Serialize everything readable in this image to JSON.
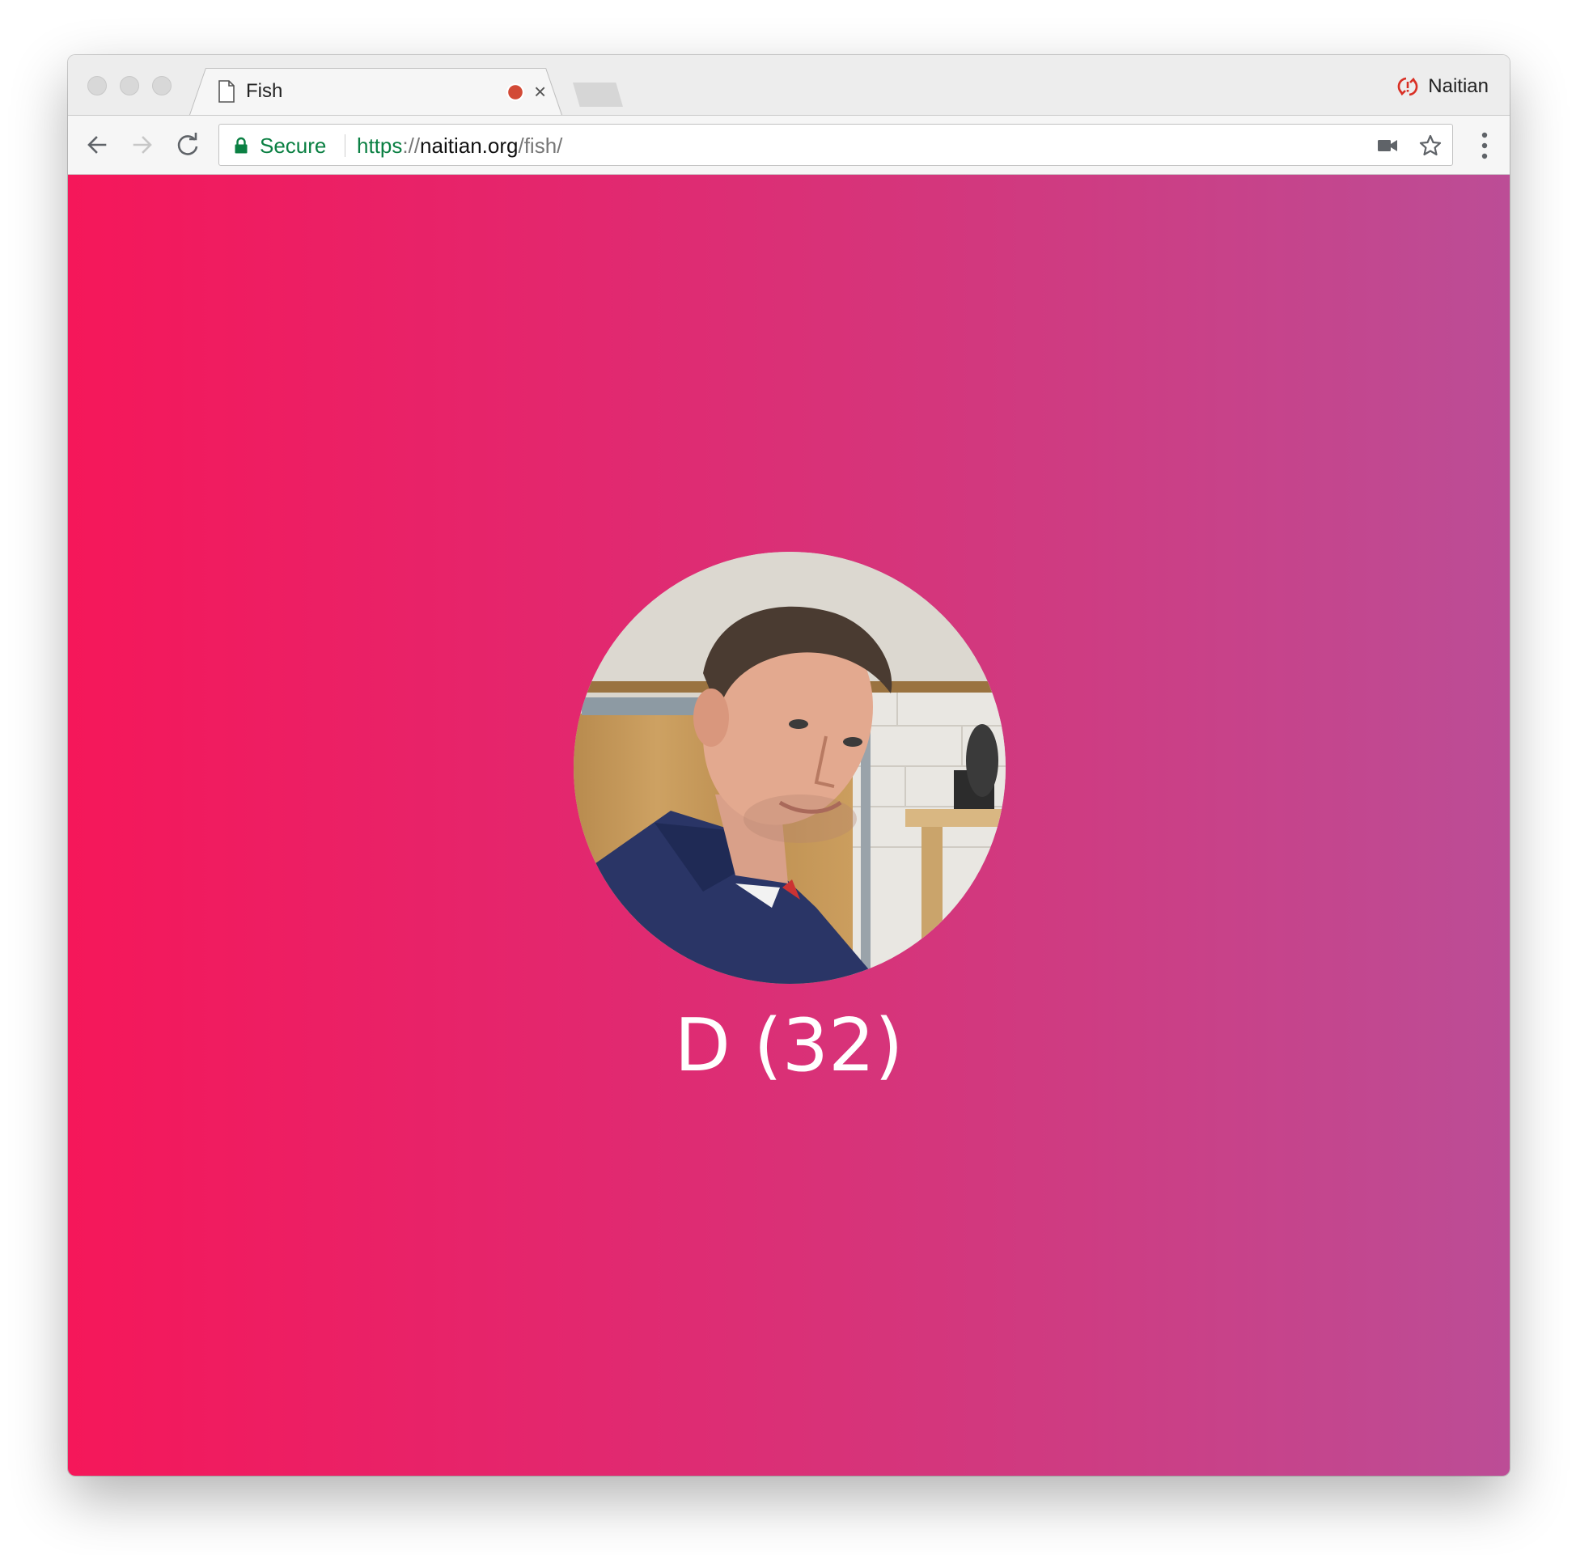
{
  "browser": {
    "tab": {
      "title": "Fish"
    },
    "profile": {
      "name": "Naitian"
    },
    "omnibox": {
      "secure_label": "Secure",
      "url_scheme": "https",
      "url_separator": "://",
      "url_host": "naitian.org",
      "url_path": "/fish/"
    },
    "colors": {
      "secure": "#0b8043",
      "record": "#d24a36"
    }
  },
  "page": {
    "background_colors": [
      "#f5175a",
      "#bc4d96"
    ],
    "avatar": {
      "icon": "person-photo"
    },
    "name_label": "D (32)"
  }
}
